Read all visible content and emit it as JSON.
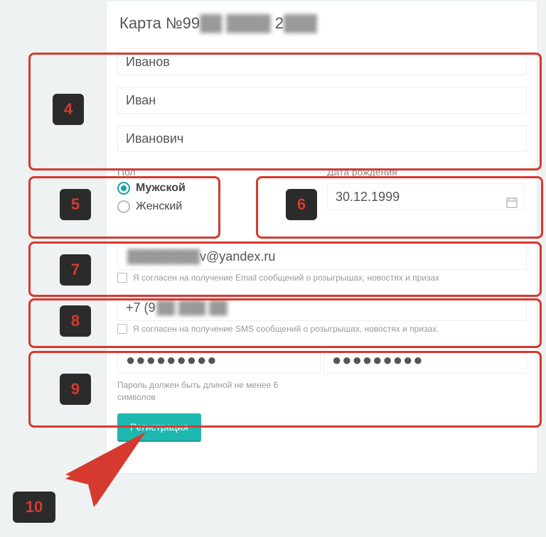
{
  "title": {
    "prefix": "Карта №99",
    "mid_blur": "██ ████",
    "suffix": " 2",
    "end_blur": "███"
  },
  "fields": {
    "last_name": {
      "value": "Иванов"
    },
    "first_name": {
      "value": "Иван",
      "blur": " "
    },
    "middle_name": {
      "value": "Иванович"
    },
    "gender": {
      "label": "Пол",
      "male": "Мужской",
      "female": "Женский",
      "selected": "male"
    },
    "dob": {
      "label": "Дата рождения",
      "value": "30.12.1999"
    },
    "email": {
      "blur": "████████",
      "value": "v@yandex.ru"
    },
    "email_consent": "Я согласен на получение Email сообщений о розыгрышах, новостях и призах",
    "phone": {
      "value": "+7 (9",
      "blur": "██ ███ ██"
    },
    "sms_consent": "Я согласен на получение SMS сообщений о розыгрышах, новостях и призах.",
    "password_dots": "●●●●●●●●●",
    "password_hint": "Пароль должен быть длиной не менее 6 символов"
  },
  "buttons": {
    "register": "Регистрация"
  },
  "callouts": {
    "n4": "4",
    "n5": "5",
    "n6": "6",
    "n7": "7",
    "n8": "8",
    "n9": "9",
    "n10": "10"
  }
}
